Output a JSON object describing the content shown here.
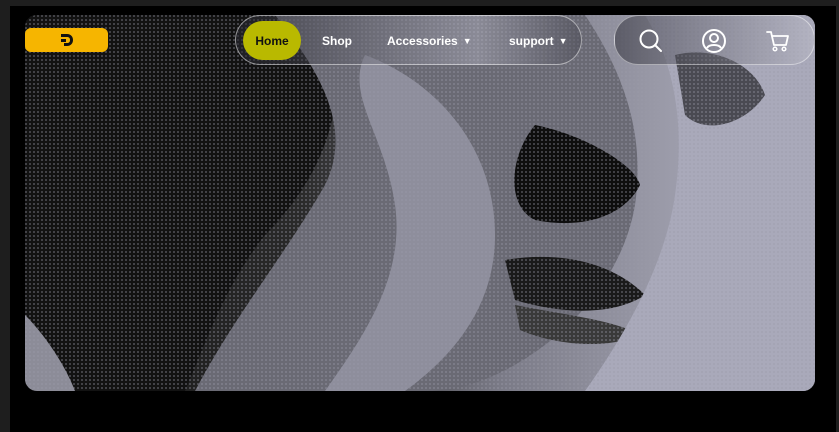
{
  "nav": {
    "items": [
      {
        "label": "Home",
        "active": true
      },
      {
        "label": "Shop"
      },
      {
        "label": "Accessories",
        "dropdown": true
      },
      {
        "label": "support",
        "dropdown": true
      }
    ]
  },
  "icons": [
    "search-icon",
    "user-account-icon",
    "cart-icon"
  ],
  "colors": {
    "logo": "#f6b500",
    "active_nav": "#b9b900",
    "page_bg": "#000000"
  }
}
